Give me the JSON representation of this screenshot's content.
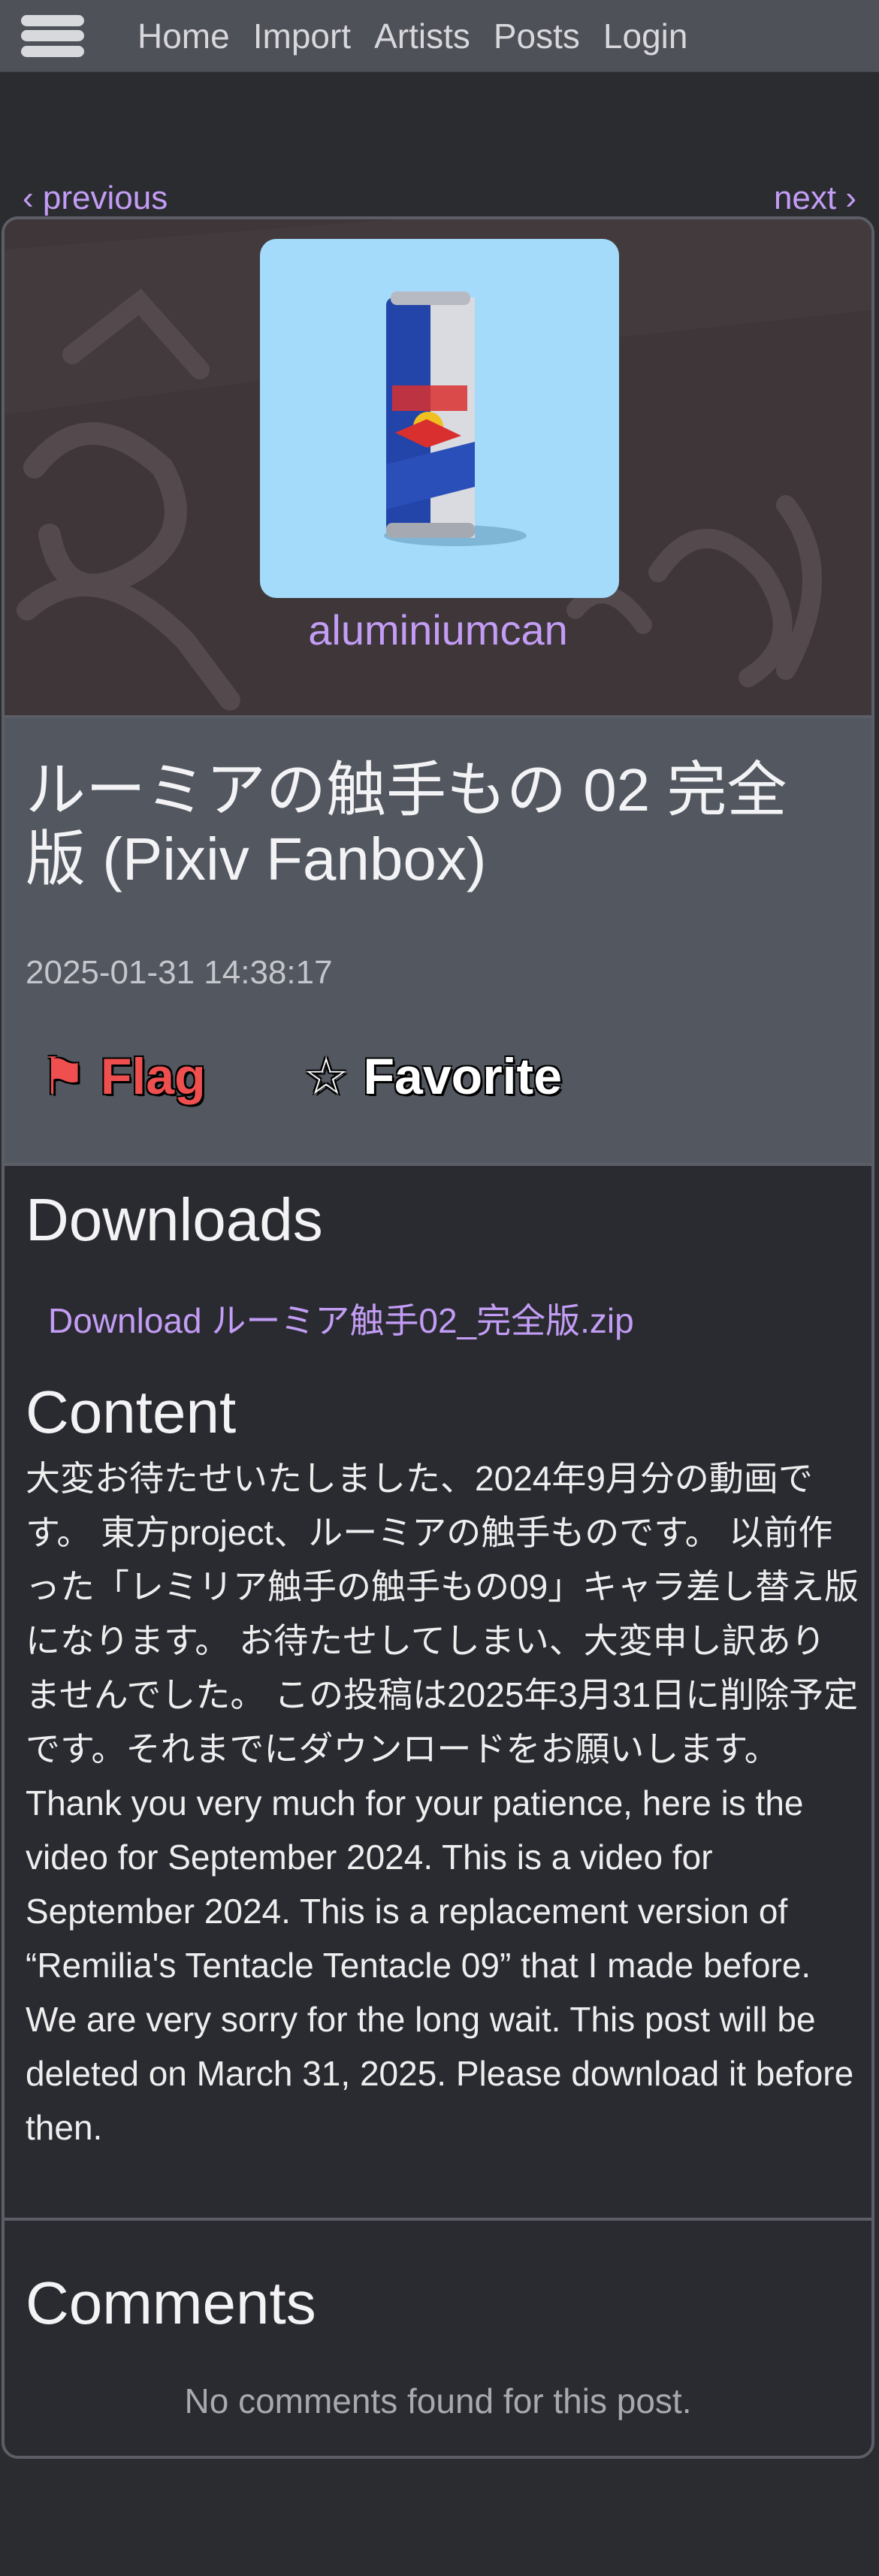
{
  "nav": {
    "links": [
      "Home",
      "Import",
      "Artists",
      "Posts",
      "Login"
    ]
  },
  "pager": {
    "previous": "‹ previous",
    "next": "next ›"
  },
  "artist": {
    "name": "aluminiumcan"
  },
  "post": {
    "title": "ルーミアの触手もの 02 完全版 (Pixiv Fanbox)",
    "date": "2025-01-31 14:38:17",
    "flag_label": "⚑ Flag",
    "favorite_label": "☆ Favorite"
  },
  "downloads": {
    "heading": "Downloads",
    "items": [
      "Download ルーミア触手02_完全版.zip"
    ]
  },
  "content": {
    "heading": "Content",
    "text": "大変お待たせいたしました、2024年9月分の動画です。 東方project、ルーミアの触手ものです。 以前作った「レミリア触手の触手もの09」キャラ差し替え版になります。 お待たせしてしまい、大変申し訳ありませんでした。 この投稿は2025年3月31日に削除予定です。それまでにダウンロードをお願いします。 Thank you very much for your patience, here is the video for September 2024. This is a video for September 2024. This is a replacement version of “Remilia's Tentacle Tentacle 09” that I made before. We are very sorry for the long wait. This post will be deleted on March 31, 2025. Please download it before then."
  },
  "comments": {
    "heading": "Comments",
    "empty_text": "No comments found for this post."
  },
  "colors": {
    "accent_link": "#c39df5",
    "page_bg": "#2b2c30",
    "header_bg": "#525760",
    "nav_bg": "#4e5158",
    "flag": "#f04f4f"
  },
  "icons": {
    "menu": "hamburger-icon",
    "avatar_image": "red-bull-can"
  }
}
